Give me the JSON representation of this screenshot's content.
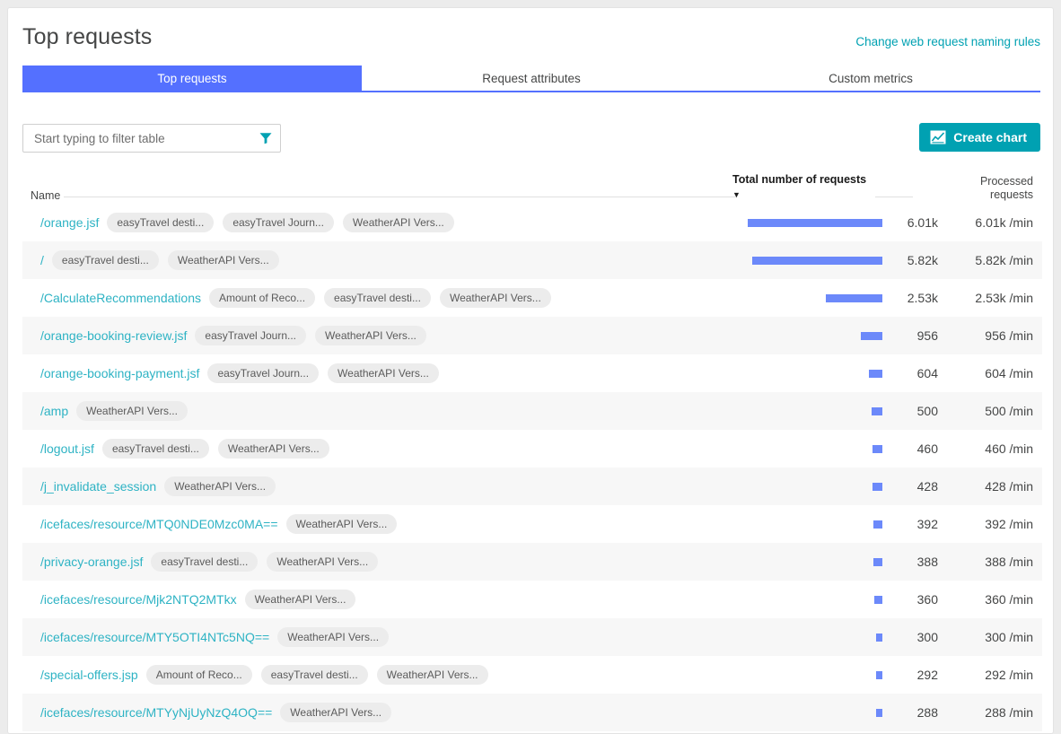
{
  "header": {
    "title": "Top requests",
    "naming_rules_link": "Change web request naming rules"
  },
  "tabs": [
    {
      "label": "Top requests",
      "active": true
    },
    {
      "label": "Request attributes",
      "active": false
    },
    {
      "label": "Custom metrics",
      "active": false
    }
  ],
  "toolbar": {
    "filter_placeholder": "Start typing to filter table",
    "filter_value": "",
    "filter_icon": "funnel-icon",
    "create_chart_label": "Create chart",
    "create_chart_icon": "line-chart-icon",
    "accent_teal": "#00a1b2",
    "accent_blue": "#5470ff",
    "bar_color": "#6c89fa",
    "link_color": "#2eb3c4"
  },
  "table": {
    "columns": {
      "name": "Name",
      "total": "Total number of requests",
      "total_sort_caret": "▼",
      "processed_line1": "Processed",
      "processed_line2": "requests"
    },
    "max_value": 6010,
    "rows": [
      {
        "name": "/orange.jsf",
        "chips": [
          "easyTravel desti...",
          "easyTravel Journ...",
          "WeatherAPI Vers..."
        ],
        "total": "6.01k",
        "value": 6010,
        "processed": "6.01k /min"
      },
      {
        "name": "/",
        "chips": [
          "easyTravel desti...",
          "WeatherAPI Vers..."
        ],
        "total": "5.82k",
        "value": 5820,
        "processed": "5.82k /min"
      },
      {
        "name": "/CalculateRecommendations",
        "chips": [
          "Amount of Reco...",
          "easyTravel desti...",
          "WeatherAPI Vers..."
        ],
        "total": "2.53k",
        "value": 2530,
        "processed": "2.53k /min"
      },
      {
        "name": "/orange-booking-review.jsf",
        "chips": [
          "easyTravel Journ...",
          "WeatherAPI Vers..."
        ],
        "total": "956",
        "value": 956,
        "processed": "956 /min"
      },
      {
        "name": "/orange-booking-payment.jsf",
        "chips": [
          "easyTravel Journ...",
          "WeatherAPI Vers..."
        ],
        "total": "604",
        "value": 604,
        "processed": "604 /min"
      },
      {
        "name": "/amp",
        "chips": [
          "WeatherAPI Vers..."
        ],
        "total": "500",
        "value": 500,
        "processed": "500 /min"
      },
      {
        "name": "/logout.jsf",
        "chips": [
          "easyTravel desti...",
          "WeatherAPI Vers..."
        ],
        "total": "460",
        "value": 460,
        "processed": "460 /min"
      },
      {
        "name": "/j_invalidate_session",
        "chips": [
          "WeatherAPI Vers..."
        ],
        "total": "428",
        "value": 428,
        "processed": "428 /min"
      },
      {
        "name": "/icefaces/resource/MTQ0NDE0Mzc0MA==",
        "chips": [
          "WeatherAPI Vers..."
        ],
        "total": "392",
        "value": 392,
        "processed": "392 /min"
      },
      {
        "name": "/privacy-orange.jsf",
        "chips": [
          "easyTravel desti...",
          "WeatherAPI Vers..."
        ],
        "total": "388",
        "value": 388,
        "processed": "388 /min"
      },
      {
        "name": "/icefaces/resource/Mjk2NTQ2MTkx",
        "chips": [
          "WeatherAPI Vers..."
        ],
        "total": "360",
        "value": 360,
        "processed": "360 /min"
      },
      {
        "name": "/icefaces/resource/MTY5OTI4NTc5NQ==",
        "chips": [
          "WeatherAPI Vers..."
        ],
        "total": "300",
        "value": 300,
        "processed": "300 /min"
      },
      {
        "name": "/special-offers.jsp",
        "chips": [
          "Amount of Reco...",
          "easyTravel desti...",
          "WeatherAPI Vers..."
        ],
        "total": "292",
        "value": 292,
        "processed": "292 /min"
      },
      {
        "name": "/icefaces/resource/MTYyNjUyNzQ4OQ==",
        "chips": [
          "WeatherAPI Vers..."
        ],
        "total": "288",
        "value": 288,
        "processed": "288 /min"
      }
    ]
  }
}
